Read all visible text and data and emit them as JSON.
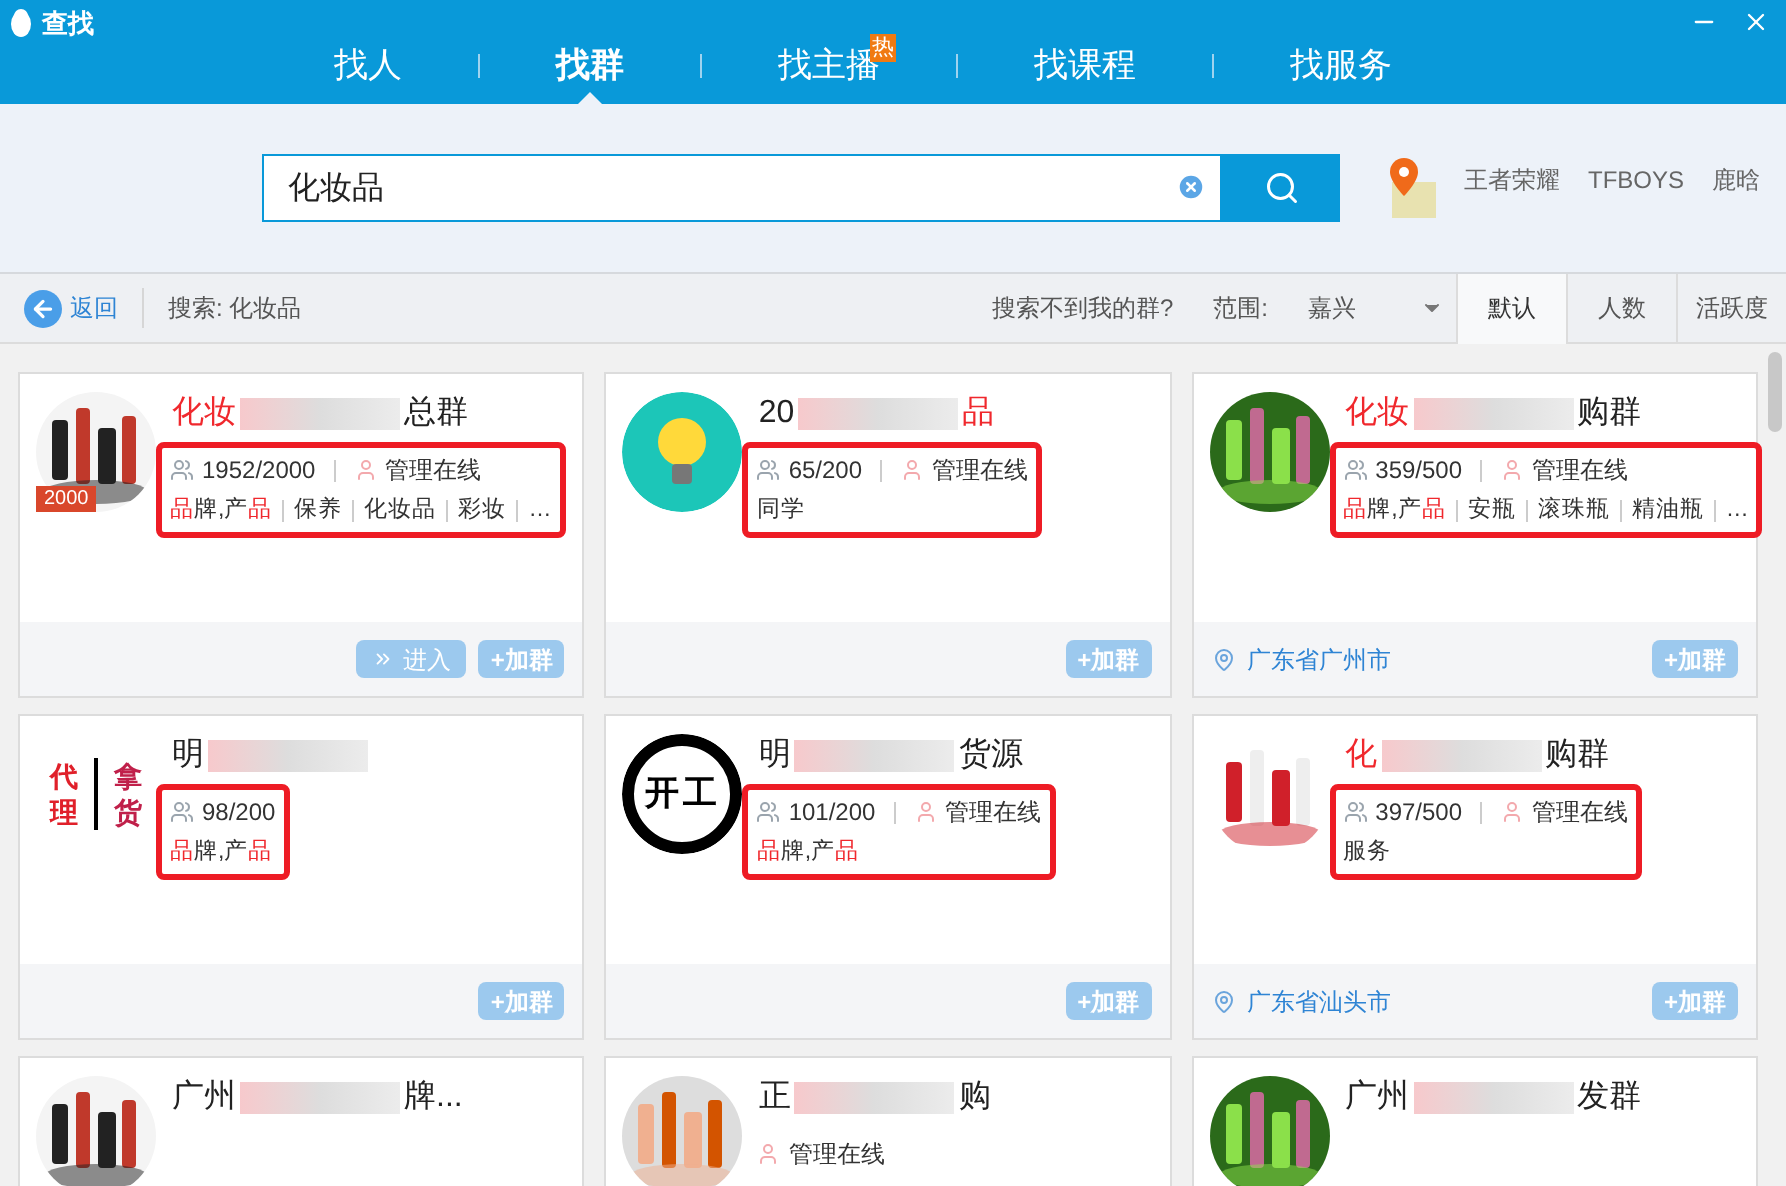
{
  "window": {
    "title": "查找"
  },
  "tabs": [
    {
      "label": "找人",
      "selected": false
    },
    {
      "label": "找群",
      "selected": true
    },
    {
      "label": "找主播",
      "selected": false,
      "badge": "热"
    },
    {
      "label": "找课程",
      "selected": false
    },
    {
      "label": "找服务",
      "selected": false
    }
  ],
  "search": {
    "value": "化妆品"
  },
  "hot_keywords": [
    "王者荣耀",
    "TFBOYS",
    "鹿晗"
  ],
  "toolbar": {
    "back": "返回",
    "query": "搜索: 化妆品",
    "help": "搜索不到我的群?",
    "range_label": "范围:",
    "range_value": "嘉兴",
    "sorts": [
      {
        "label": "默认",
        "selected": true
      },
      {
        "label": "人数",
        "selected": false
      },
      {
        "label": "活跃度",
        "selected": false
      }
    ]
  },
  "groups": [
    {
      "avatar": {
        "kind": "picture",
        "badge": "2000"
      },
      "name": [
        {
          "text": "化妆",
          "hl": true
        },
        {
          "blur": true
        },
        {
          "text": "总群"
        }
      ],
      "members": "1952/2000",
      "admin": "管理在线",
      "tags": [
        [
          {
            "text": "品",
            "hl": true
          },
          {
            "text": "牌,产"
          },
          {
            "text": "品",
            "hl": true
          }
        ],
        [
          {
            "text": "保养"
          }
        ],
        [
          {
            "text": "化妆品"
          }
        ],
        [
          {
            "text": "彩妆"
          }
        ],
        [
          {
            "text": "…"
          }
        ]
      ],
      "annotated": true,
      "enter": "进入",
      "join": "+加群"
    },
    {
      "avatar": {
        "kind": "bulb"
      },
      "name": [
        {
          "text": "20"
        },
        {
          "blur": true
        },
        {
          "text": "品",
          "hl": true
        }
      ],
      "members": "65/200",
      "admin": "管理在线",
      "tags": [
        [
          {
            "text": "同学"
          }
        ]
      ],
      "annotated": true,
      "join": "+加群"
    },
    {
      "avatar": {
        "kind": "picture"
      },
      "name": [
        {
          "text": "化妆",
          "hl": true
        },
        {
          "blur": true
        },
        {
          "text": "购群"
        }
      ],
      "members": "359/500",
      "admin": "管理在线",
      "tags": [
        [
          {
            "text": "品",
            "hl": true
          },
          {
            "text": "牌,产"
          },
          {
            "text": "品",
            "hl": true
          }
        ],
        [
          {
            "text": "安瓶"
          }
        ],
        [
          {
            "text": "滚珠瓶"
          }
        ],
        [
          {
            "text": "精油瓶"
          }
        ],
        [
          {
            "text": "…"
          }
        ]
      ],
      "annotated": true,
      "location": "广东省广州市",
      "join": "+加群"
    },
    {
      "avatar": {
        "kind": "text",
        "lines": [
          "代理",
          "拿货"
        ]
      },
      "name": [
        {
          "text": "明"
        },
        {
          "blur": true
        }
      ],
      "members": "98/200",
      "tags": [
        [
          {
            "text": "品",
            "hl": true
          },
          {
            "text": "牌,产"
          },
          {
            "text": "品",
            "hl": true
          }
        ]
      ],
      "annotated": true,
      "join": "+加群"
    },
    {
      "avatar": {
        "kind": "seal",
        "text": "开工"
      },
      "name": [
        {
          "text": "明"
        },
        {
          "blur": true
        },
        {
          "text": "货源"
        }
      ],
      "members": "101/200",
      "admin": "管理在线",
      "tags": [
        [
          {
            "text": "品",
            "hl": true
          },
          {
            "text": "牌,产"
          },
          {
            "text": "品",
            "hl": true
          }
        ]
      ],
      "annotated": true,
      "join": "+加群"
    },
    {
      "avatar": {
        "kind": "picture"
      },
      "name": [
        {
          "text": "化",
          "hl": true
        },
        {
          "blur": true
        },
        {
          "text": "购群"
        }
      ],
      "members": "397/500",
      "admin": "管理在线",
      "tags": [
        [
          {
            "text": "服务"
          }
        ]
      ],
      "annotated": true,
      "location": "广东省汕头市",
      "join": "+加群"
    },
    {
      "avatar": {
        "kind": "picture"
      },
      "name": [
        {
          "text": "广州"
        },
        {
          "blur": true
        },
        {
          "text": "牌..."
        }
      ],
      "annotated": false
    },
    {
      "avatar": {
        "kind": "picture"
      },
      "name": [
        {
          "text": "正"
        },
        {
          "blur": true
        },
        {
          "text": "购"
        }
      ],
      "admin": "管理在线",
      "annotated": false
    },
    {
      "avatar": {
        "kind": "picture"
      },
      "name": [
        {
          "text": "广州"
        },
        {
          "blur": true
        },
        {
          "text": "发群"
        }
      ],
      "annotated": false
    }
  ]
}
